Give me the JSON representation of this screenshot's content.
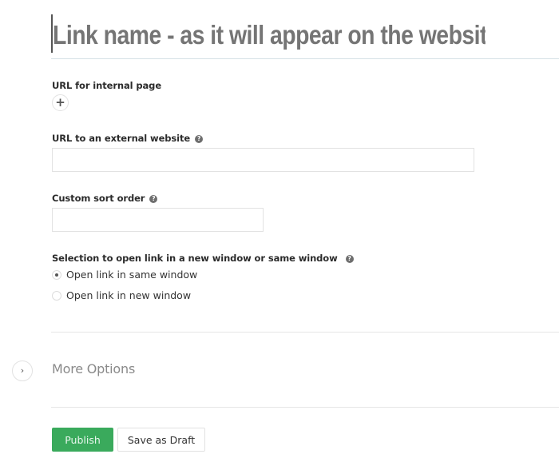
{
  "title_field": {
    "placeholder": "Link name - as it will appear on the website",
    "value": ""
  },
  "internal_url": {
    "label": "URL for internal page",
    "add_icon": "plus-icon",
    "add_glyph": "+"
  },
  "external_url": {
    "label": "URL to an external website",
    "help_icon": "question-circle-icon",
    "help_glyph": "?",
    "value": ""
  },
  "sort_order": {
    "label": "Custom sort order",
    "help_icon": "question-circle-icon",
    "help_glyph": "?",
    "value": ""
  },
  "window_selection": {
    "label": "Selection to open link in a new window or same window",
    "help_icon": "question-circle-icon",
    "help_glyph": "?",
    "options": [
      {
        "label": "Open link in same window",
        "checked": true
      },
      {
        "label": "Open link in new window",
        "checked": false
      }
    ]
  },
  "more_options": {
    "label": "More Options",
    "toggle_icon": "chevron-right-icon",
    "toggle_glyph": "›"
  },
  "actions": {
    "publish_label": "Publish",
    "draft_label": "Save as Draft"
  },
  "colors": {
    "publish_bg": "#3aaa5c",
    "placeholder_text": "#c8c8c8"
  }
}
